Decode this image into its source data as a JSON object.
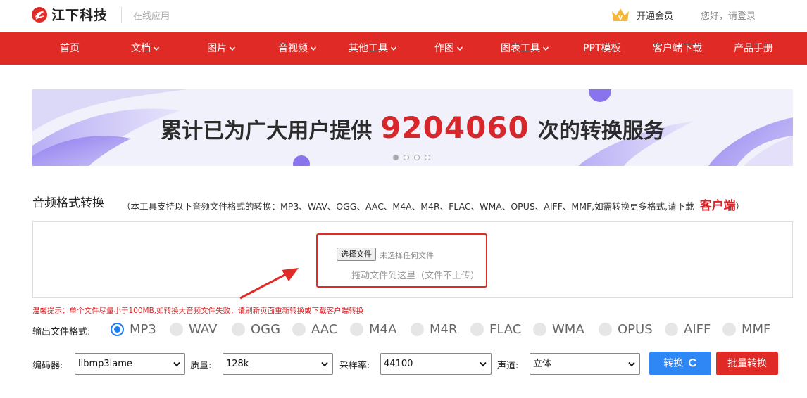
{
  "header": {
    "brand": "江下科技",
    "subtitle": "在线应用",
    "vip_label": "开通会员",
    "login_label": "您好，请登录",
    "colors": {
      "brand_red": "#e02a26",
      "vip_gold": "#f5b63a"
    }
  },
  "nav": {
    "items": [
      {
        "label": "首页",
        "dropdown": false
      },
      {
        "label": "文档",
        "dropdown": true
      },
      {
        "label": "图片",
        "dropdown": true
      },
      {
        "label": "音视频",
        "dropdown": true
      },
      {
        "label": "其他工具",
        "dropdown": true
      },
      {
        "label": "作图",
        "dropdown": true
      },
      {
        "label": "图表工具",
        "dropdown": true
      },
      {
        "label": "PPT模板",
        "dropdown": false
      },
      {
        "label": "客户端下载",
        "dropdown": false
      },
      {
        "label": "产品手册",
        "dropdown": false
      }
    ]
  },
  "banner": {
    "prefix": "累计已为广大用户提供",
    "count": "9204060",
    "suffix": "次的转换服务",
    "slides": 4,
    "active_slide": 1
  },
  "tool": {
    "title": "音频格式转换",
    "note_prefix": "（本工具支持以下音频文件格式的转换：MP3、WAV、OGG、AAC、M4A、M4R、FLAC、WMA、OPUS、AIFF、MMF,如需转换更多格式,请下载",
    "note_link": "客户端",
    "note_suffix": "）"
  },
  "upload": {
    "choose_button": "选择文件",
    "no_file_text": "未选择任何文件",
    "drop_hint": "拖动文件到这里（文件不上传）"
  },
  "tip": "温馨提示：单个文件尽量小于100MB,如转换大音频文件失败，请刷新页面重新转换或下载客户端转换",
  "output": {
    "label": "输出文件格式:",
    "formats": [
      "MP3",
      "WAV",
      "OGG",
      "AAC",
      "M4A",
      "M4R",
      "FLAC",
      "WMA",
      "OPUS",
      "AIFF",
      "MMF"
    ],
    "selected": "MP3"
  },
  "controls": {
    "encoder_label": "编码器:",
    "encoder_value": "libmp3lame",
    "quality_label": "质量:",
    "quality_value": "128k",
    "samplerate_label": "采样率:",
    "samplerate_value": "44100",
    "channel_label": "声道:",
    "channel_value": "立体",
    "convert_button": "转换",
    "batch_button": "批量转换"
  }
}
